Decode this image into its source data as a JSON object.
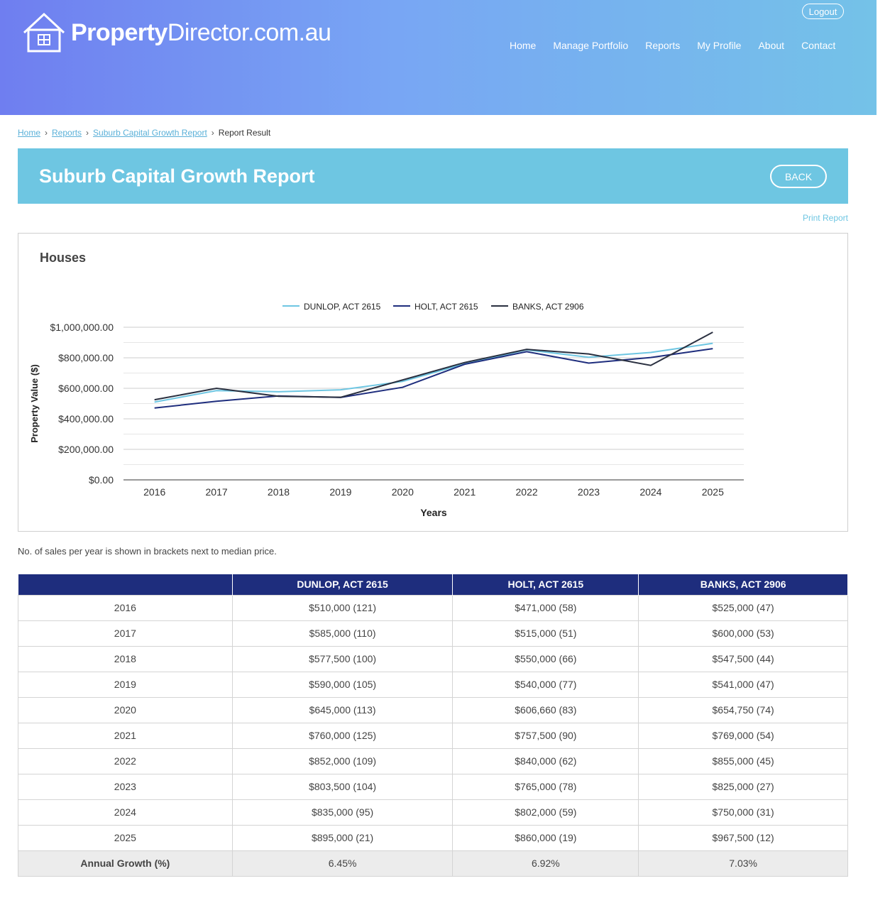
{
  "header": {
    "logo_bold": "Property",
    "logo_light": "Director.com.au",
    "logout_label": "Logout",
    "nav": [
      "Home",
      "Manage Portfolio",
      "Reports",
      "My Profile",
      "About",
      "Contact"
    ]
  },
  "breadcrumb": {
    "items": [
      "Home",
      "Reports",
      "Suburb Capital Growth Report"
    ],
    "current": "Report Result"
  },
  "page": {
    "title": "Suburb Capital Growth Report",
    "back_label": "BACK",
    "print_label": "Print Report",
    "note": "No. of sales per year is shown in brackets next to median price."
  },
  "chart": {
    "heading": "Houses"
  },
  "chart_data": {
    "type": "line",
    "title": "Houses",
    "xlabel": "Years",
    "ylabel": "Property Value ($)",
    "x": [
      "2016",
      "2017",
      "2018",
      "2019",
      "2020",
      "2021",
      "2022",
      "2023",
      "2024",
      "2025"
    ],
    "ylim": [
      0,
      1000000
    ],
    "yticks": [
      "$0.00",
      "$200,000.00",
      "$400,000.00",
      "$600,000.00",
      "$800,000.00",
      "$1,000,000.00"
    ],
    "grid": true,
    "legend": "top-center",
    "series": [
      {
        "name": "DUNLOP, ACT 2615",
        "color": "#6ec6e2",
        "values": [
          510000,
          585000,
          577500,
          590000,
          645000,
          760000,
          852000,
          803500,
          835000,
          895000
        ]
      },
      {
        "name": "HOLT, ACT 2615",
        "color": "#1e2d7d",
        "values": [
          471000,
          515000,
          550000,
          540000,
          606660,
          757500,
          840000,
          765000,
          802000,
          860000
        ]
      },
      {
        "name": "BANKS, ACT 2906",
        "color": "#2a3040",
        "values": [
          525000,
          600000,
          547500,
          541000,
          654750,
          769000,
          855000,
          825000,
          750000,
          967500
        ]
      }
    ]
  },
  "table": {
    "headers": [
      "",
      "DUNLOP, ACT 2615",
      "HOLT, ACT 2615",
      "BANKS, ACT 2906"
    ],
    "rows": [
      [
        "2016",
        "$510,000 (121)",
        "$471,000 (58)",
        "$525,000 (47)"
      ],
      [
        "2017",
        "$585,000 (110)",
        "$515,000 (51)",
        "$600,000 (53)"
      ],
      [
        "2018",
        "$577,500 (100)",
        "$550,000 (66)",
        "$547,500 (44)"
      ],
      [
        "2019",
        "$590,000 (105)",
        "$540,000 (77)",
        "$541,000 (47)"
      ],
      [
        "2020",
        "$645,000 (113)",
        "$606,660 (83)",
        "$654,750 (74)"
      ],
      [
        "2021",
        "$760,000 (125)",
        "$757,500 (90)",
        "$769,000 (54)"
      ],
      [
        "2022",
        "$852,000 (109)",
        "$840,000 (62)",
        "$855,000 (45)"
      ],
      [
        "2023",
        "$803,500 (104)",
        "$765,000 (78)",
        "$825,000 (27)"
      ],
      [
        "2024",
        "$835,000 (95)",
        "$802,000 (59)",
        "$750,000 (31)"
      ],
      [
        "2025",
        "$895,000 (21)",
        "$860,000 (19)",
        "$967,500 (12)"
      ]
    ],
    "growth": [
      "Annual Growth (%)",
      "6.45%",
      "6.92%",
      "7.03%"
    ]
  }
}
